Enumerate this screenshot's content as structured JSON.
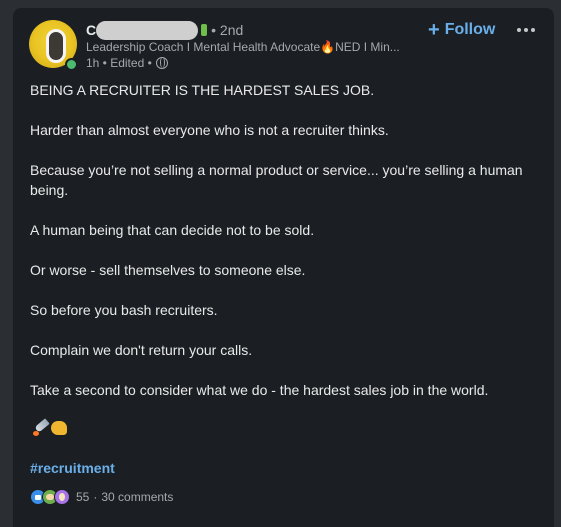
{
  "author": {
    "name_initial": "C",
    "degree": "• 2nd",
    "headline": "Leadership Coach I Mental Health Advocate🔥NED I Min...",
    "time": "1h • Edited •"
  },
  "actions": {
    "follow_plus": "+",
    "follow_label": "Follow"
  },
  "post": {
    "paragraphs": [
      "BEING A RECRUITER IS THE HARDEST SALES JOB.",
      "Harder than almost everyone who is not a recruiter thinks.",
      "Because you’re not selling a normal product or service... you’re selling a human being.",
      "A human being that can decide not to be sold.",
      "Or worse - sell themselves to someone else.",
      "So before you bash recruiters.",
      "Complain we don't return your calls.",
      "Take a second to consider what we do - the hardest sales job in the world."
    ],
    "emoji_icons": [
      "rocket-icon",
      "flexed-biceps-icon"
    ],
    "hashtag": "#recruitment"
  },
  "social": {
    "reaction_icons": [
      "like-icon",
      "support-icon",
      "insightful-icon"
    ],
    "reaction_count": "55",
    "separator": "·",
    "comments": "30 comments"
  },
  "colors": {
    "background": "#1b1f23",
    "link_blue": "#6aafe9",
    "text": "#e9e9e9",
    "muted": "#a6a8ab"
  }
}
